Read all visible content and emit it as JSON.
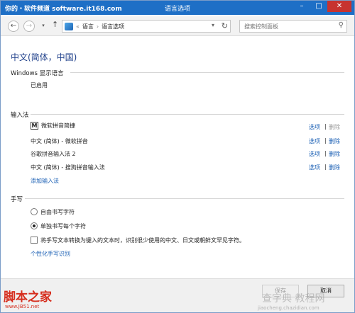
{
  "watermark_top": "你的・软件频道 software.it168.com",
  "window": {
    "title": "语言选项"
  },
  "nav": {
    "back_icon": "arrow-left-icon",
    "forward_icon": "arrow-right-icon",
    "up_icon": "arrow-up-icon",
    "breadcrumb": {
      "prefix": "«",
      "item1": "语言",
      "sep": "›",
      "item2": "语言选项"
    },
    "search_placeholder": "搜索控制面板"
  },
  "page_title": "中文(简体，中国)",
  "display_language": {
    "heading": "Windows 显示语言",
    "status": "已启用"
  },
  "ime": {
    "heading": "输入法",
    "items": [
      {
        "label": "微软拼音简捷",
        "icon": "M",
        "options": "选项",
        "delete": "删除",
        "delete_enabled": false
      },
      {
        "label": "中文 (简体) - 微软拼音",
        "options": "选项",
        "delete": "删除",
        "delete_enabled": true
      },
      {
        "label": "谷歌拼音输入法 2",
        "options": "选项",
        "delete": "删除",
        "delete_enabled": true
      },
      {
        "label": "中文 (简体) - 搜狗拼音输入法",
        "options": "选项",
        "delete": "删除",
        "delete_enabled": true
      }
    ],
    "separator": "|",
    "add_link": "添加输入法"
  },
  "handwriting": {
    "heading": "手写",
    "radio_freeform": "自由书写字符",
    "radio_single": "单独书写每个字符",
    "selected": "single",
    "checkbox_label": "将手写文本转换为键入的文本时，识别很少使用的中文、日文或朝鲜文罕见字符。",
    "checkbox_checked": false,
    "personalize_link": "个性化手写识别"
  },
  "footer": {
    "save": "保存",
    "cancel": "取消"
  },
  "watermark_bottom": {
    "brand": "脚本之家",
    "url": "www.JB51.net",
    "right": "查字典 教程网",
    "right_url": "jiaocheng.chazidian.com"
  },
  "colors": {
    "titlebar": "#1e6fc6",
    "link": "#1a5fb4",
    "heading": "#1e3f8a",
    "watermark": "#d62e1e"
  }
}
